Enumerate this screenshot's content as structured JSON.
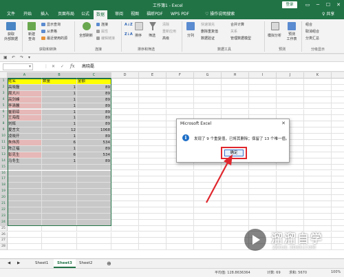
{
  "window": {
    "title": "工作簿1 - Excel",
    "login_label": "登录",
    "controls": [
      "▭",
      "─",
      "☐",
      "✕"
    ]
  },
  "menu": {
    "tabs": [
      "文件",
      "开始",
      "插入",
      "页面布局",
      "公式",
      "数据",
      "审阅",
      "视图",
      "福昕PDF",
      "WPS PDF"
    ],
    "active_tab": "数据",
    "help": "♡ 操作说明搜索",
    "share": "♀ 共享"
  },
  "ribbon": {
    "items": {
      "get_external": "获取\n外部数据",
      "new_query": "新建\n查询",
      "show_queries": "显示查询",
      "from_table": "从表格",
      "recent_sources": "最近使用的源",
      "refresh_all": "全部刷新",
      "connections": "连接",
      "properties": "属性",
      "edit_links": "编辑链接",
      "sort_az": "A↓Z",
      "sort_za": "Z↓A",
      "sort": "排序",
      "filter": "筛选",
      "clear": "清除",
      "reapply": "重新应用",
      "advanced": "高级",
      "text_to_columns": "分列",
      "flash_fill": "快速填充",
      "remove_duplicates": "删除重复值",
      "data_validation": "数据验证",
      "consolidate": "合并计算",
      "relationships": "关系",
      "manage_model": "管理数据模型",
      "what_if": "模拟分析",
      "forecast_sheet": "预测\n工作表",
      "group": "组合",
      "ungroup": "取消组合",
      "subtotal": "分类汇总"
    },
    "groups": {
      "get_transform": "获取和转换",
      "connections": "连接",
      "sort_filter": "排序和筛选",
      "data_tools": "数据工具",
      "forecast": "预测",
      "outline": "分级显示"
    }
  },
  "formula_bar": {
    "name_box": "",
    "fx": "fx",
    "value": "高晓磊"
  },
  "sheet": {
    "columns": [
      "A",
      "B",
      "C",
      "D",
      "E",
      "F",
      "G",
      "H",
      "I",
      "J",
      "K",
      "L"
    ],
    "row_numbers": [
      "1",
      "2",
      "3",
      "4",
      "5",
      "6",
      "7",
      "8",
      "9",
      "10",
      "11",
      "12",
      "13",
      "14",
      "15",
      "16",
      "17",
      "18",
      "19",
      "20",
      "21",
      "22",
      "23",
      "24",
      "25",
      "26",
      "27",
      "28"
    ],
    "headers": [
      "姓名",
      "数量",
      "金额"
    ],
    "rows": [
      {
        "name": "高晓磊",
        "qty": "1",
        "amount": "89",
        "pink": false
      },
      {
        "name": "周大川",
        "qty": "1",
        "amount": "89",
        "pink": true
      },
      {
        "name": "高剑峰",
        "qty": "1",
        "amount": "89",
        "pink": true
      },
      {
        "name": "李清麓",
        "qty": "1",
        "amount": "89",
        "pink": true
      },
      {
        "name": "崔丽琼",
        "qty": "1",
        "amount": "89",
        "pink": true
      },
      {
        "name": "王海霞",
        "qty": "1",
        "amount": "89",
        "pink": true
      },
      {
        "name": "刘辉",
        "qty": "1",
        "amount": "89",
        "pink": false
      },
      {
        "name": "夏言文",
        "qty": "12",
        "amount": "1068",
        "pink": false
      },
      {
        "name": "凌晓开",
        "qty": "1",
        "amount": "89",
        "pink": false
      },
      {
        "name": "朱伟芳",
        "qty": "6",
        "amount": "534",
        "pink": true
      },
      {
        "name": "陈正福",
        "qty": "1",
        "amount": "89",
        "pink": false
      },
      {
        "name": "彭克生",
        "qty": "6",
        "amount": "534",
        "pink": true
      },
      {
        "name": "马冬生",
        "qty": "1",
        "amount": "89",
        "pink": false
      }
    ]
  },
  "dialog": {
    "title": "Microsoft Excel",
    "close": "✕",
    "icon": "i",
    "message": "发现了 9 个重复值，已将其删除；保留了 13 个唯一值。",
    "ok": "确定"
  },
  "sheet_tabs": {
    "tabs": [
      "Sheet1",
      "Sheet3",
      "Sheet2"
    ],
    "active": "Sheet3",
    "add": "⊕"
  },
  "status": {
    "average": "平均值: 128.8636364",
    "count": "计数: 69",
    "sum": "求和: 5670",
    "zoom": "100%"
  },
  "watermark": {
    "title": "溜溜自学",
    "url": "ZIXUE.3D66.COM"
  },
  "colors": {
    "excel_green": "#217346",
    "header_yellow": "#ffff00",
    "dup_pink": "#e6b8b7",
    "selection_gray": "#c8c8c8",
    "highlight_red": "#e0262d"
  }
}
